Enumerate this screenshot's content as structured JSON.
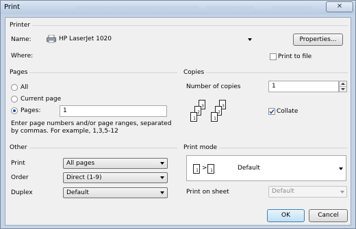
{
  "title": "Print",
  "printer": {
    "section": "Printer",
    "name_label": "Name:",
    "name_value": "HP LaserJet 1020",
    "properties": "Properties...",
    "where_label": "Where:",
    "print_to_file": "Print to file"
  },
  "pages": {
    "section": "Pages",
    "all": "All",
    "current": "Current page",
    "pages_label": "Pages:",
    "pages_value": "1",
    "help": "Enter page numbers and/or page ranges, separated by commas.  For example, 1,3,5-12"
  },
  "copies": {
    "section": "Copies",
    "number_label": "Number of copies",
    "number_value": "1",
    "collate": "Collate",
    "page_numbers": [
      "1",
      "2",
      "3"
    ]
  },
  "other": {
    "section": "Other",
    "print_label": "Print",
    "print_value": "All pages",
    "order_label": "Order",
    "order_value": "Direct (1-9)",
    "duplex_label": "Duplex",
    "duplex_value": "Default"
  },
  "print_mode": {
    "section": "Print mode",
    "mode_value": "Default",
    "sheet_label": "Print on sheet",
    "sheet_value": "Default"
  },
  "buttons": {
    "ok": "OK",
    "cancel": "Cancel"
  },
  "state": {
    "selected_range": "pages",
    "collate_checked": true,
    "print_to_file_checked": false
  }
}
